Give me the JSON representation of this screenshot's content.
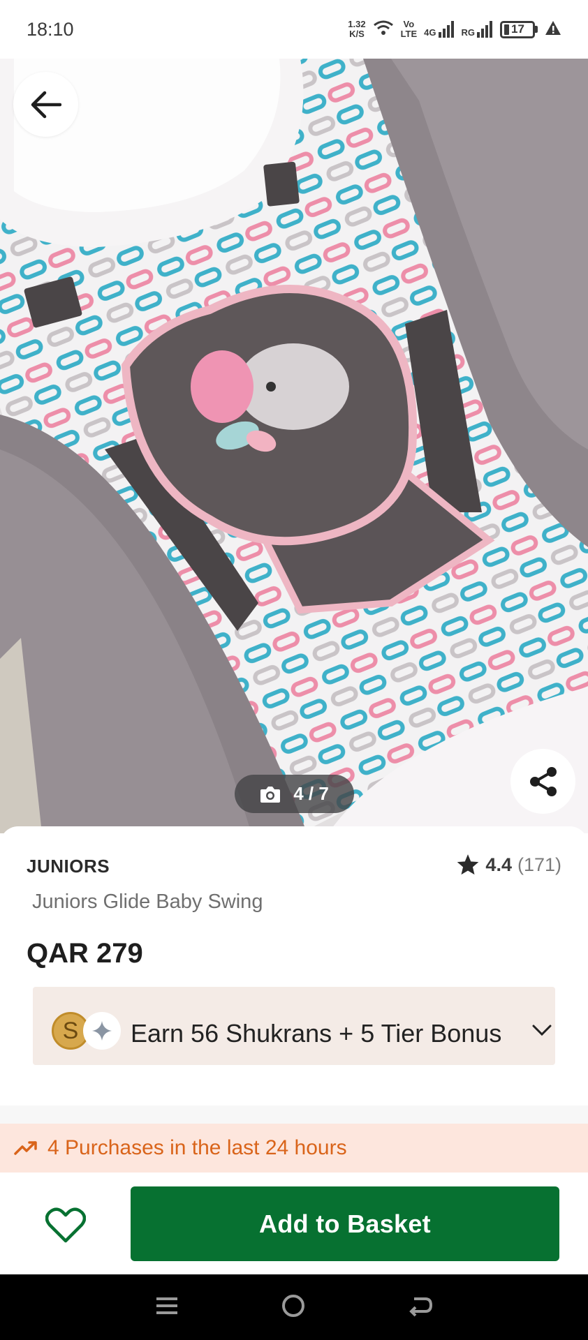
{
  "status_bar": {
    "time": "18:10",
    "net_speed_value": "1.32",
    "net_speed_unit": "K/S",
    "volte_top": "Vo",
    "volte_bottom": "LTE",
    "network_1": "4G",
    "network_2": "RG",
    "battery_level": "17"
  },
  "gallery": {
    "counter": "4 / 7",
    "back_icon": "arrow-left-icon",
    "share_icon": "share-icon",
    "camera_icon": "camera-icon"
  },
  "product": {
    "brand": "JUNIORS",
    "name": "Juniors Glide Baby Swing",
    "price": "QAR 279",
    "rating": "4.4",
    "rating_count": "(171)"
  },
  "shukran": {
    "text": "Earn 56 Shukrans + 5 Tier Bonus",
    "coin_letter": "S"
  },
  "purchases": {
    "text": "4 Purchases in the last 24 hours"
  },
  "actions": {
    "add_to_basket": "Add to Basket",
    "wishlist_icon": "heart-outline-icon"
  },
  "colors": {
    "primary_green": "#077131",
    "purchases_orange": "#d9641a",
    "purchases_bg": "#fde6dd",
    "shukran_bg": "#f4ebe6"
  }
}
